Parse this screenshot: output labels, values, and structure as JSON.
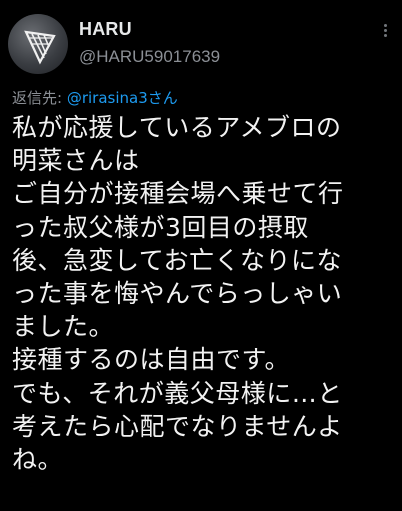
{
  "tweet": {
    "display_name": "HARU",
    "handle": "@HARU59017639",
    "reply_prefix": "返信先: ",
    "reply_mention": "@rirasina3さん",
    "body_lines": [
      "私が応援しているアメブロの",
      "明菜さんは",
      "ご自分が接種会場へ乗せて行",
      "った叔父様が3回目の摂取",
      "後、急変してお亡くなりにな",
      "った事を悔やんでらっしゃい",
      "ました。",
      "接種するのは自由です。",
      "でも、それが義父母様に…と",
      "考えたら心配でなりませんよ",
      "ね。"
    ]
  },
  "icons": {
    "avatar": "avatar-image",
    "more": "more-vertical-icon"
  },
  "colors": {
    "background": "#000000",
    "text": "#e7e9ea",
    "secondary": "#8b8f95",
    "link": "#1d9bf0"
  }
}
